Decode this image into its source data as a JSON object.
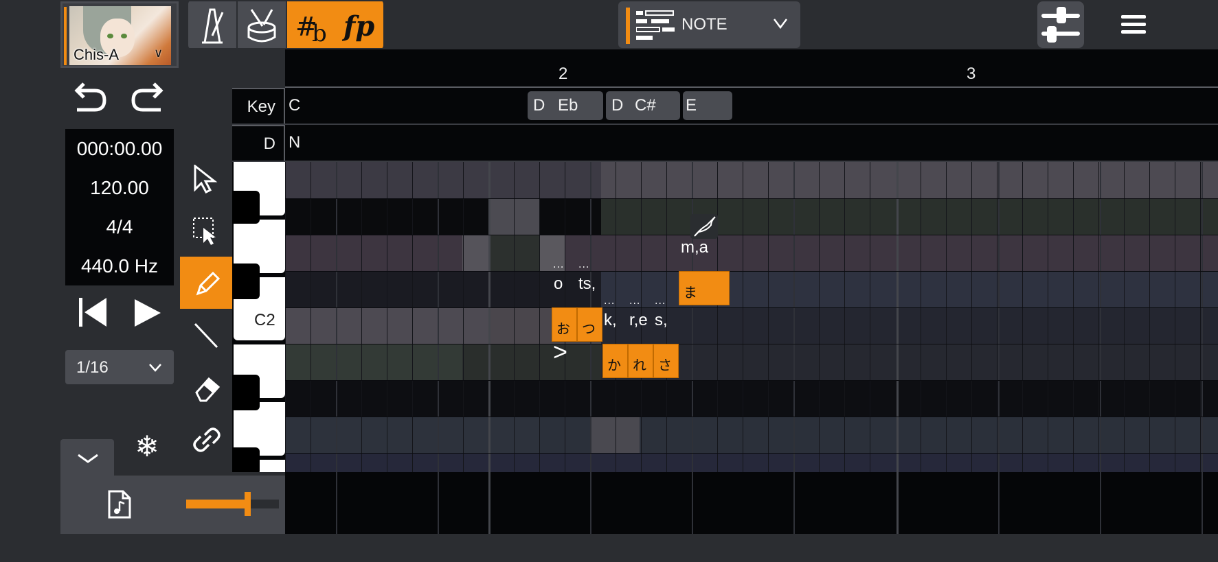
{
  "voicebank": {
    "name": "Chis-A"
  },
  "transport": {
    "time": "000:00.00",
    "tempo": "120.00",
    "time_signature": "4/4",
    "tuning": "440.0 Hz"
  },
  "quantize": {
    "value": "1/16"
  },
  "mode_selector": {
    "label": "NOTE"
  },
  "timeline": {
    "measures": [
      "2",
      "3"
    ],
    "key_label": "Key",
    "d_label": "D",
    "keys": [
      "C",
      "D",
      "Eb",
      "D",
      "C#",
      "E"
    ],
    "d_values": [
      "N"
    ]
  },
  "piano": {
    "c2_label": "C2"
  },
  "notes": [
    {
      "lyric": "お",
      "phoneme": "o"
    },
    {
      "lyric": "つ",
      "phoneme": "ts,"
    },
    {
      "lyric": "か",
      "phoneme": "k,"
    },
    {
      "lyric": "れ",
      "phoneme": "r,e"
    },
    {
      "lyric": "さ",
      "phoneme": "s,"
    },
    {
      "lyric": "ま",
      "phoneme": "m,a"
    }
  ],
  "accent_mark": ">",
  "colors": {
    "accent": "#f28c13",
    "panel": "#45474d",
    "background": "#2b2d31",
    "grid": "#050608"
  },
  "volume": {
    "level_percent": 66
  }
}
